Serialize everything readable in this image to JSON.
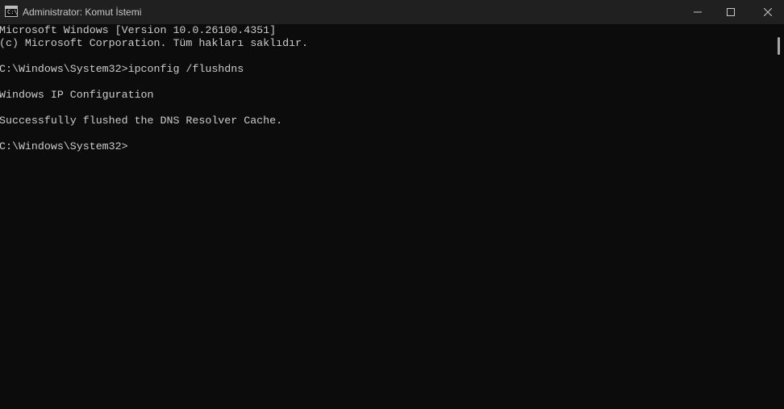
{
  "window": {
    "title": "Administrator: Komut İstemi",
    "app_icon_glyph": "C:\\"
  },
  "terminal": {
    "lines": [
      "Microsoft Windows [Version 10.0.26100.4351]",
      "(c) Microsoft Corporation. Tüm hakları saklıdır.",
      "",
      "C:\\Windows\\System32>ipconfig /flushdns",
      "",
      "Windows IP Configuration",
      "",
      "Successfully flushed the DNS Resolver Cache.",
      "",
      "C:\\Windows\\System32>"
    ],
    "colors": {
      "background": "#0c0c0c",
      "foreground": "#cccccc"
    }
  },
  "icons": {
    "app": "command-prompt-icon",
    "minimize": "minimize-icon",
    "maximize": "maximize-icon",
    "close": "close-icon"
  }
}
